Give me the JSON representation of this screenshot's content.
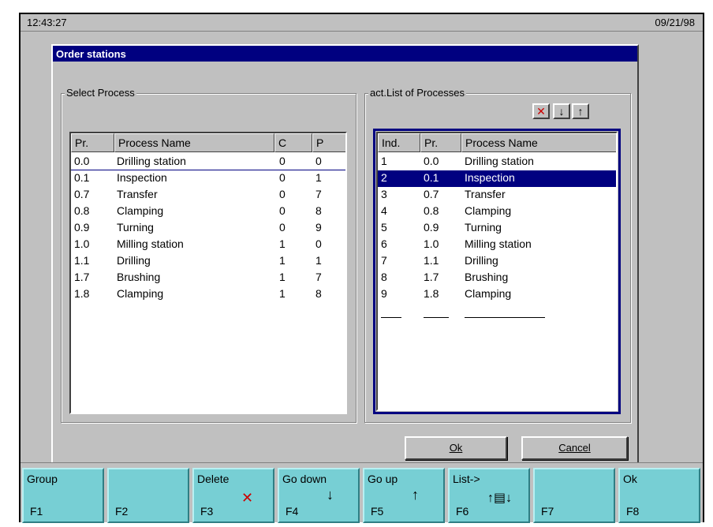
{
  "status": {
    "time": "12:43:27",
    "date": "09/21/98"
  },
  "dialog": {
    "title": "Order stations"
  },
  "select_process": {
    "legend": "Select Process",
    "columns": [
      "Pr.",
      "Process Name",
      "C",
      "P"
    ],
    "rows": [
      [
        "0.0",
        "Drilling station",
        "0",
        "0"
      ],
      [
        "0.1",
        "Inspection",
        "0",
        "1"
      ],
      [
        "0.7",
        "Transfer",
        "0",
        "7"
      ],
      [
        "0.8",
        "Clamping",
        "0",
        "8"
      ],
      [
        "0.9",
        "Turning",
        "0",
        "9"
      ],
      [
        "1.0",
        "Milling station",
        "1",
        "0"
      ],
      [
        "1.1",
        "Drilling",
        "1",
        "1"
      ],
      [
        "1.7",
        "Brushing",
        "1",
        "7"
      ],
      [
        "1.8",
        "Clamping",
        "1",
        "8"
      ]
    ]
  },
  "act_list": {
    "legend": "act.List of Processes",
    "columns": [
      "Ind.",
      "Pr.",
      "Process Name"
    ],
    "selected_index": 1,
    "rows": [
      [
        "1",
        "0.0",
        "Drilling station"
      ],
      [
        "2",
        "0.1",
        "Inspection"
      ],
      [
        "3",
        "0.7",
        "Transfer"
      ],
      [
        "4",
        "0.8",
        "Clamping"
      ],
      [
        "5",
        "0.9",
        "Turning"
      ],
      [
        "6",
        "1.0",
        "Milling station"
      ],
      [
        "7",
        "1.1",
        "Drilling"
      ],
      [
        "8",
        "1.7",
        "Brushing"
      ],
      [
        "9",
        "1.8",
        "Clamping"
      ]
    ],
    "toolbar_icons": [
      "delete-icon",
      "arrow-down-icon",
      "arrow-up-icon"
    ]
  },
  "buttons": {
    "ok": "Ok",
    "cancel": "Cancel"
  },
  "fkeys": [
    {
      "label": "Group",
      "key": "F1",
      "icon": ""
    },
    {
      "label": "",
      "key": "F2",
      "icon": ""
    },
    {
      "label": "Delete",
      "key": "F3",
      "icon": "delete-icon"
    },
    {
      "label": "Go down",
      "key": "F4",
      "icon": "arrow-down-icon"
    },
    {
      "label": "Go up",
      "key": "F5",
      "icon": "arrow-up-icon"
    },
    {
      "label": "List->",
      "key": "F6",
      "icon": "list-icon"
    },
    {
      "label": "",
      "key": "F7",
      "icon": ""
    },
    {
      "label": "Ok",
      "key": "F8",
      "icon": ""
    }
  ],
  "colors": {
    "selection": "#000080",
    "fkey": "#77cfd4",
    "delete": "#cc0000"
  }
}
